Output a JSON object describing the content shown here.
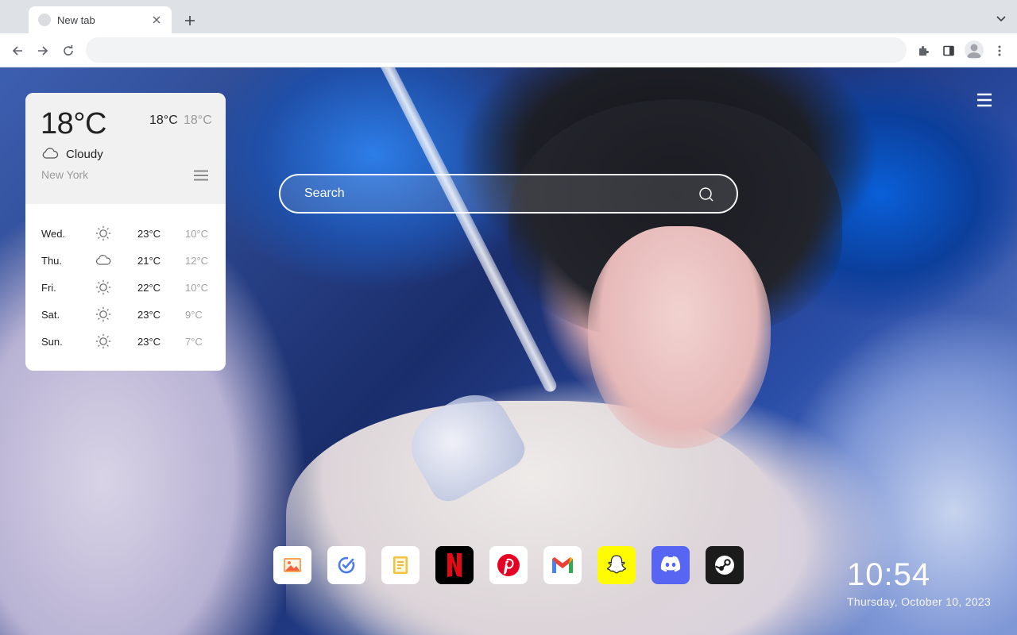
{
  "browser": {
    "tab_title": "New tab",
    "address_value": ""
  },
  "weather": {
    "current_temp": "18°C",
    "high": "18°C",
    "low": "18°C",
    "condition": "Cloudy",
    "condition_icon": "cloud-icon",
    "city": "New York",
    "forecast": [
      {
        "day": "Wed.",
        "icon": "sun-icon",
        "high": "23°C",
        "low": "10°C"
      },
      {
        "day": "Thu.",
        "icon": "cloud-icon",
        "high": "21°C",
        "low": "12°C"
      },
      {
        "day": "Fri.",
        "icon": "sun-icon",
        "high": "22°C",
        "low": "10°C"
      },
      {
        "day": "Sat.",
        "icon": "sun-icon",
        "high": "23°C",
        "low": "9°C"
      },
      {
        "day": "Sun.",
        "icon": "sun-icon",
        "high": "23°C",
        "low": "7°C"
      }
    ]
  },
  "search": {
    "placeholder": "Search"
  },
  "dock": [
    {
      "name": "photos",
      "icon": "photo-icon",
      "bg": "#ffffff"
    },
    {
      "name": "tasks",
      "icon": "check-circle-icon",
      "bg": "#ffffff"
    },
    {
      "name": "notes",
      "icon": "note-icon",
      "bg": "#ffffff"
    },
    {
      "name": "netflix",
      "icon": "netflix-icon",
      "bg": "#000000"
    },
    {
      "name": "pinterest",
      "icon": "pinterest-icon",
      "bg": "#ffffff"
    },
    {
      "name": "gmail",
      "icon": "gmail-icon",
      "bg": "#ffffff"
    },
    {
      "name": "snapchat",
      "icon": "snapchat-icon",
      "bg": "#fffc00"
    },
    {
      "name": "discord",
      "icon": "discord-icon",
      "bg": "#5865f2"
    },
    {
      "name": "steam",
      "icon": "steam-icon",
      "bg": "#1b1b1b"
    }
  ],
  "clock": {
    "time": "10:54",
    "date": "Thursday, October 10, 2023"
  }
}
